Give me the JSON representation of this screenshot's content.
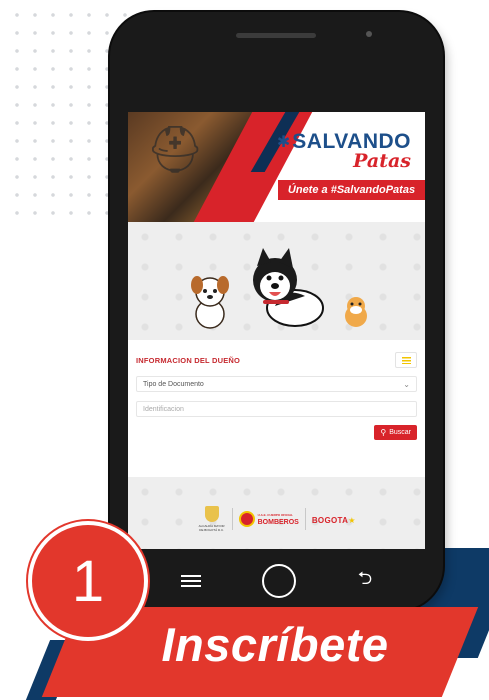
{
  "banner": {
    "brand_main": "SALVANDO",
    "brand_sub": "Patas",
    "slogan": "Únete a #SalvandoPatas"
  },
  "form": {
    "section_title": "INFORMACION DEL DUEÑO",
    "document_type_value": "Tipo de Documento",
    "identification_placeholder": "Identificacion",
    "search_label": "Buscar"
  },
  "footer": {
    "alcaldia_text": "ALCALDÍA MAYOR DE BOGOTÁ D.C.",
    "bomberos_line1": "U.A.E. CUERPO OFICIAL",
    "bomberos_line2": "BOMBEROS",
    "bogota_text": "BOGOTA"
  },
  "step": {
    "number": "1",
    "title": "Inscríbete"
  },
  "colors": {
    "brand_red": "#d8232a",
    "brand_navy": "#0e3a66",
    "accent_yellow": "#f2c500"
  }
}
